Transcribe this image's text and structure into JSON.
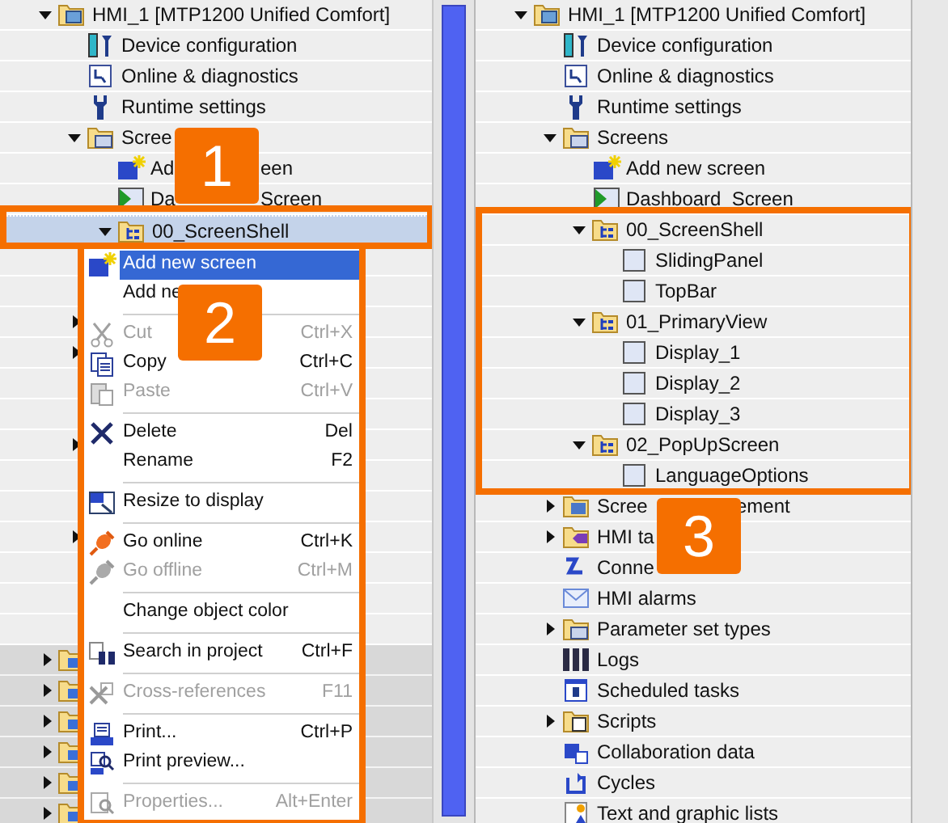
{
  "left_tree": {
    "items": [
      {
        "label": "HMI_1 [MTP1200 Unified Comfort]",
        "kind": "device",
        "expanded": true,
        "selected": false,
        "children": [
          {
            "label": "Device configuration",
            "kind": "config",
            "selected": false
          },
          {
            "label": "Online & diagnostics",
            "kind": "diag",
            "selected": false
          },
          {
            "label": "Runtime settings",
            "kind": "runtime",
            "selected": false
          },
          {
            "label": "Scree",
            "kind": "folder",
            "expanded": true,
            "selected": false,
            "children": [
              {
                "label": "Ad",
                "label_after": "een",
                "kind": "add",
                "selected": false
              },
              {
                "label": "Da",
                "label_after": "Screen",
                "kind": "start",
                "selected": false
              },
              {
                "label": "00_ScreenShell",
                "kind": "group",
                "expanded": true,
                "selected": true
              }
            ]
          }
        ]
      }
    ],
    "covered_rows": [
      {
        "kind": "blank"
      },
      {
        "kind": "blank"
      },
      {
        "kind": "subfolder"
      },
      {
        "kind": "subfolder"
      },
      {
        "kind": "blank"
      },
      {
        "kind": "blank"
      },
      {
        "kind": "subfolder"
      },
      {
        "kind": "blank"
      },
      {
        "kind": "blank"
      },
      {
        "kind": "subfolder"
      },
      {
        "kind": "blank"
      },
      {
        "kind": "blank"
      },
      {
        "kind": "blank"
      },
      {
        "kind": "folder"
      },
      {
        "kind": "folder"
      },
      {
        "kind": "folder"
      },
      {
        "kind": "folder"
      },
      {
        "kind": "folder"
      },
      {
        "kind": "folder"
      }
    ]
  },
  "context_menu": [
    {
      "kind": "item",
      "label": "Add new screen",
      "selected": true,
      "disabled": false
    },
    {
      "kind": "item",
      "label": "Add ne",
      "selected": false,
      "disabled": false
    },
    {
      "kind": "separator"
    },
    {
      "kind": "item",
      "label": "Cut",
      "shortcut": "Ctrl+X",
      "selected": false,
      "disabled": true
    },
    {
      "kind": "item",
      "label": "Copy",
      "shortcut": "Ctrl+C",
      "selected": false,
      "disabled": false
    },
    {
      "kind": "item",
      "label": "Paste",
      "shortcut": "Ctrl+V",
      "selected": false,
      "disabled": true
    },
    {
      "kind": "separator"
    },
    {
      "kind": "item",
      "label": "Delete",
      "shortcut": "Del",
      "selected": false,
      "disabled": false
    },
    {
      "kind": "item",
      "label": "Rename",
      "shortcut": "F2",
      "selected": false,
      "disabled": false
    },
    {
      "kind": "separator"
    },
    {
      "kind": "item",
      "label": "Resize to display",
      "selected": false,
      "disabled": false
    },
    {
      "kind": "separator"
    },
    {
      "kind": "item",
      "label": "Go online",
      "shortcut": "Ctrl+K",
      "selected": false,
      "disabled": false
    },
    {
      "kind": "item",
      "label": "Go offline",
      "shortcut": "Ctrl+M",
      "selected": false,
      "disabled": true
    },
    {
      "kind": "separator"
    },
    {
      "kind": "item",
      "label": "Change object color",
      "selected": false,
      "disabled": false
    },
    {
      "kind": "separator"
    },
    {
      "kind": "item",
      "label": "Search in project",
      "shortcut": "Ctrl+F",
      "selected": false,
      "disabled": false
    },
    {
      "kind": "separator"
    },
    {
      "kind": "item",
      "label": "Cross-references",
      "shortcut": "F11",
      "selected": false,
      "disabled": true
    },
    {
      "kind": "separator"
    },
    {
      "kind": "item",
      "label": "Print...",
      "shortcut": "Ctrl+P",
      "selected": false,
      "disabled": false
    },
    {
      "kind": "item",
      "label": "Print preview...",
      "selected": false,
      "disabled": false
    },
    {
      "kind": "separator"
    },
    {
      "kind": "item",
      "label": "Properties...",
      "shortcut": "Alt+Enter",
      "selected": false,
      "disabled": true
    }
  ],
  "right_tree": {
    "items": [
      {
        "label": "HMI_1 [MTP1200 Unified Comfort]",
        "kind": "device",
        "expanded": true,
        "children": [
          {
            "label": "Device configuration",
            "kind": "config"
          },
          {
            "label": "Online & diagnostics",
            "kind": "diag"
          },
          {
            "label": "Runtime settings",
            "kind": "runtime"
          },
          {
            "label": "Screens",
            "kind": "folder",
            "expanded": true,
            "children": [
              {
                "label": "Add new screen",
                "kind": "add"
              },
              {
                "label": "Dashboard_Screen",
                "kind": "start"
              },
              {
                "label": "00_ScreenShell",
                "kind": "group",
                "expanded": true,
                "children": [
                  {
                    "label": "SlidingPanel",
                    "kind": "screen"
                  },
                  {
                    "label": "TopBar",
                    "kind": "screen"
                  }
                ]
              },
              {
                "label": "01_PrimaryView",
                "kind": "group",
                "expanded": true,
                "children": [
                  {
                    "label": "Display_1",
                    "kind": "screen"
                  },
                  {
                    "label": "Display_2",
                    "kind": "screen"
                  },
                  {
                    "label": "Display_3",
                    "kind": "screen"
                  }
                ]
              },
              {
                "label": "02_PopUpScreen",
                "kind": "group",
                "expanded": true,
                "children": [
                  {
                    "label": "LanguageOptions",
                    "kind": "screen"
                  }
                ]
              }
            ]
          },
          {
            "label": "Scree",
            "label_after": "ement",
            "kind": "screen_mgmt",
            "expanded": false
          },
          {
            "label": "HMI ta",
            "kind": "tags",
            "expanded": false
          },
          {
            "label": "Conne",
            "kind": "connections"
          },
          {
            "label": "HMI alarms",
            "kind": "alarms"
          },
          {
            "label": "Parameter set types",
            "kind": "folder",
            "expanded": false
          },
          {
            "label": "Logs",
            "kind": "logs"
          },
          {
            "label": "Scheduled tasks",
            "kind": "tasks"
          },
          {
            "label": "Scripts",
            "kind": "scripts",
            "expanded": false
          },
          {
            "label": "Collaboration data",
            "kind": "collab"
          },
          {
            "label": "Cycles",
            "kind": "cycles"
          },
          {
            "label": "Text and graphic lists",
            "kind": "textlists"
          }
        ]
      }
    ]
  },
  "callouts": [
    {
      "label": "1"
    },
    {
      "label": "2"
    },
    {
      "label": "3"
    }
  ]
}
